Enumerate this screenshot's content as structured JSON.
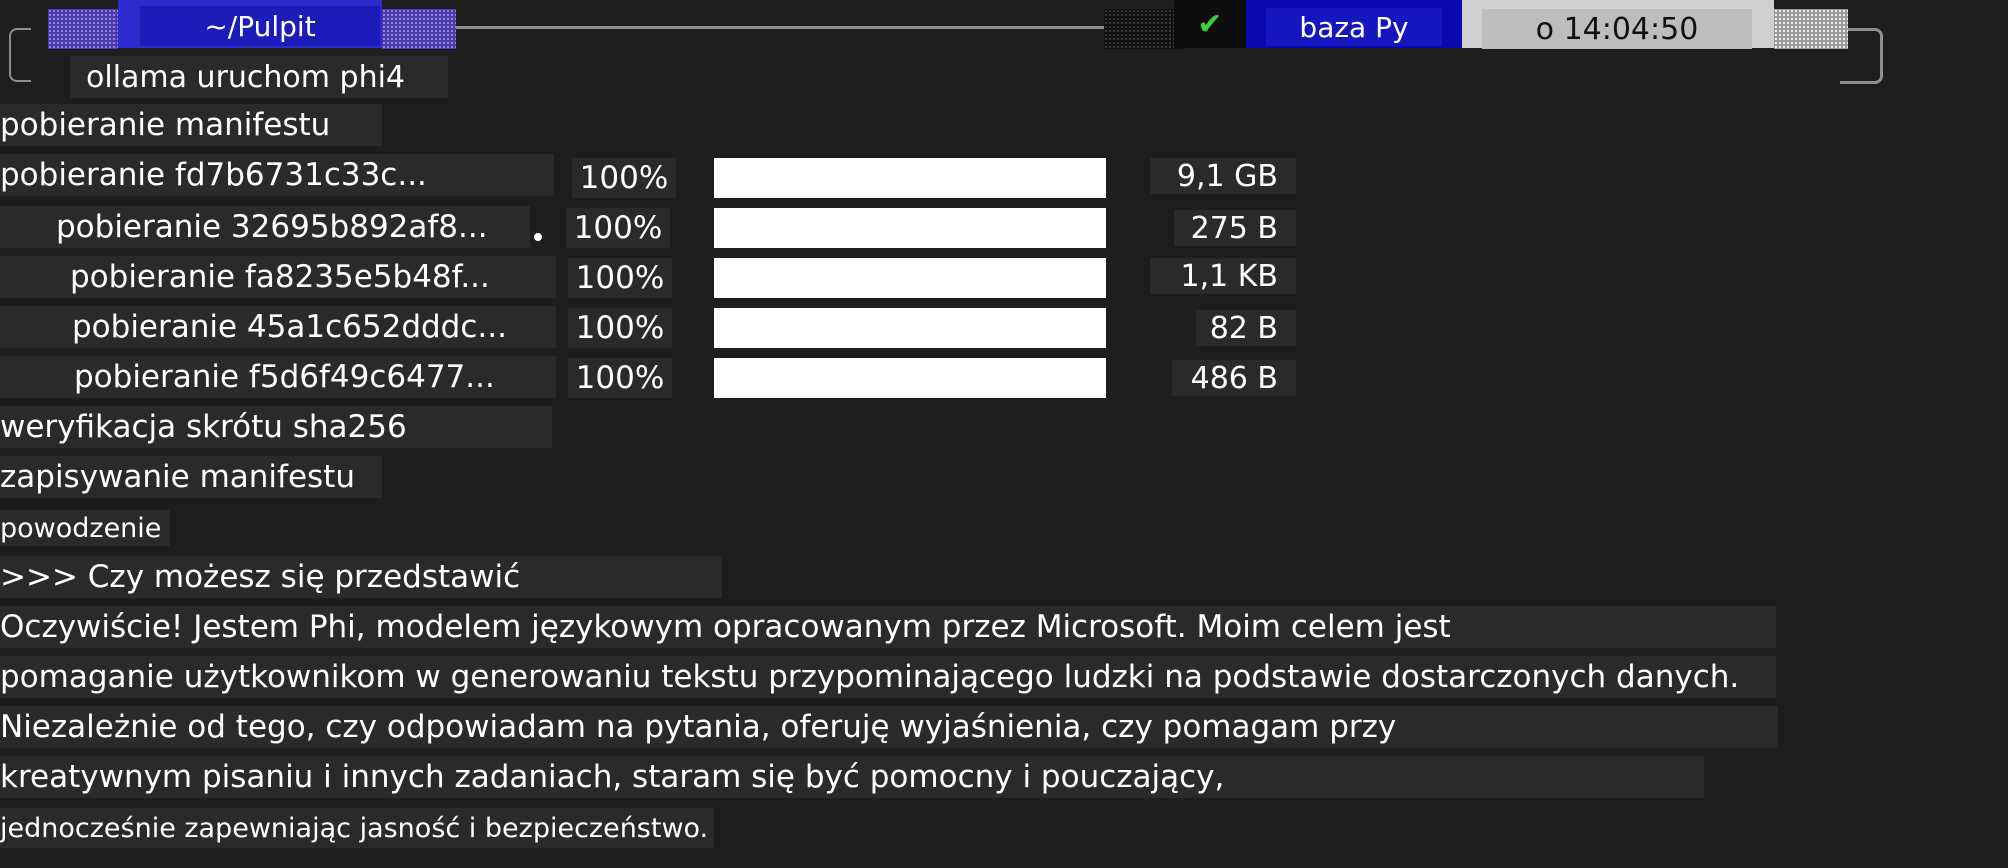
{
  "prompt": {
    "directory": "~/Pulpit",
    "status_icon": "check-mark-icon",
    "status_glyph": "✔",
    "environment": "baza Py",
    "time": "o 14:04:50"
  },
  "command": "ollama uruchom phi4",
  "pull_log": {
    "manifest_line": "pobieranie manifestu",
    "downloads": [
      {
        "label": "pobieranie fd7b6731c33c...",
        "percent": "100%",
        "progress": 1.0,
        "size": "9,1 GB"
      },
      {
        "label": "pobieranie 32695b892af8...",
        "percent": "100%",
        "progress": 1.0,
        "size": "275 B"
      },
      {
        "label": "pobieranie fa8235e5b48f...",
        "percent": "100%",
        "progress": 1.0,
        "size": "1,1 KB"
      },
      {
        "label": "pobieranie 45a1c652dddc...",
        "percent": "100%",
        "progress": 1.0,
        "size": "82 B"
      },
      {
        "label": "pobieranie f5d6f49c6477...",
        "percent": "100%",
        "progress": 1.0,
        "size": "486 B"
      }
    ],
    "verify_line": "weryfikacja skrótu sha256",
    "write_line": "zapisywanie manifestu",
    "success_line": "powodzenie"
  },
  "chat": {
    "user_prompt": ">>> Czy możesz się przedstawić",
    "response_lines": [
      "Oczywiście! Jestem Phi, modelem językowym opracowanym przez Microsoft. Moim celem jest",
      "pomaganie użytkownikom w generowaniu tekstu przypominającego ludzki na podstawie dostarczonych danych.",
      "Niezależnie od tego, czy odpowiadam na pytania, oferuję wyjaśnienia, czy pomagam przy",
      "kreatywnym pisaniu i innych zadaniach, staram się być pomocny i pouczający,",
      "jednocześnie zapewniając jasność i bezpieczeństwo."
    ]
  },
  "colors": {
    "background": "#1e1e1e",
    "line_highlight": "#2a2a2a",
    "directory_segment": "#2b2bcf",
    "environment_segment": "#0a0ab0",
    "time_segment": "#cfcfcf",
    "check_mark": "#3ccf3c",
    "progress_fill": "#ffffff"
  }
}
